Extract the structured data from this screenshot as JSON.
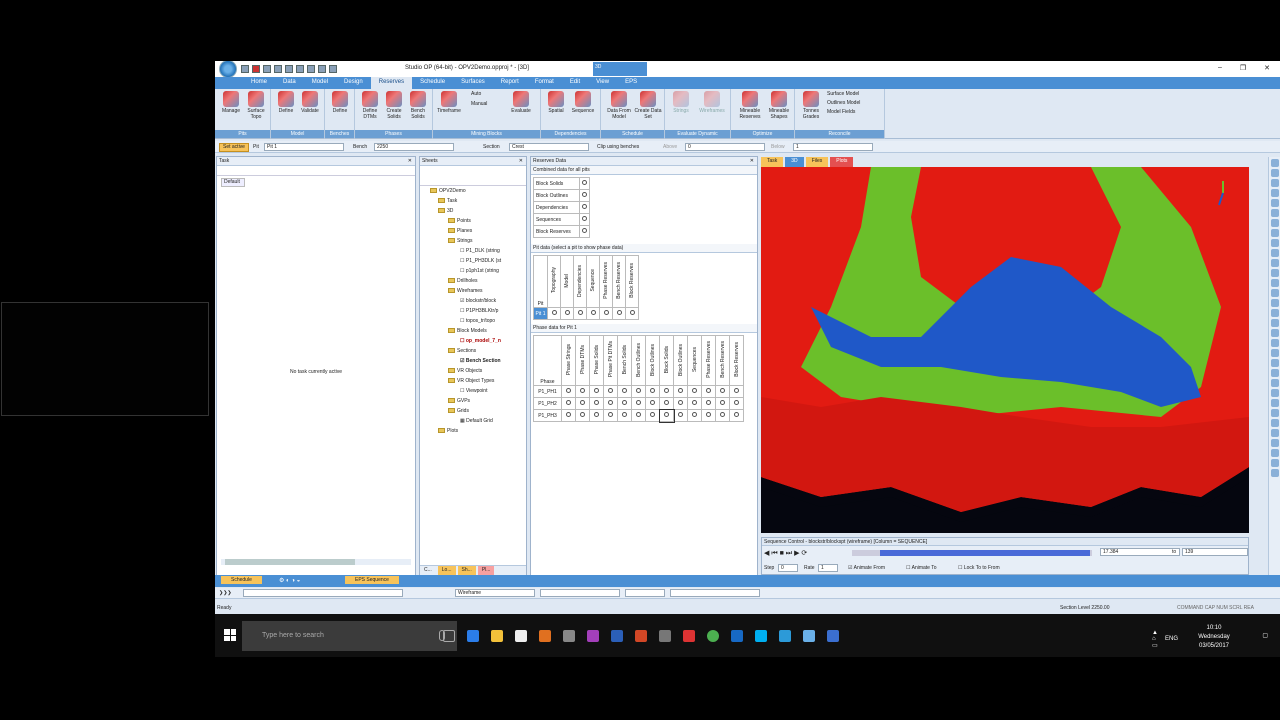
{
  "window": {
    "title": "Studio OP (64-bit) - OPV2Demo.opproj * - [3D]",
    "context_tab": "3D"
  },
  "ribbon_tabs": [
    "Home",
    "Data",
    "Model",
    "Design",
    "Reserves",
    "Schedule",
    "Surfaces",
    "Report",
    "Format",
    "Edit",
    "View",
    "EPS"
  ],
  "active_tab": "Reserves",
  "ribbon": {
    "groups": {
      "pits": "Pits",
      "model": "Model",
      "benches": "Benches",
      "phases": "Phases",
      "mining_blocks": "Mining Blocks",
      "dependencies": "Dependencies",
      "schedule": "Schedule",
      "evaluate_dynamic": "Evaluate Dynamic",
      "optimize": "Optimize",
      "reconcile": "Reconcile"
    },
    "buttons": {
      "manage": "Manage",
      "surface_topo": "Surface Topo",
      "define_model": "Define",
      "validate": "Validate",
      "define_benches": "Define",
      "define_dtms": "Define DTMs",
      "create_solids": "Create Solids",
      "bench_solids": "Bench Solids",
      "timeframe": "Timeframe",
      "auto": "Auto",
      "manual": "Manual",
      "evaluate": "Evaluate",
      "spatial": "Spatial",
      "sequence": "Sequence",
      "data_from_model": "Data From Model",
      "create_data_set": "Create Data Set",
      "strings": "Strings",
      "wireframes": "Wireframes",
      "mineable_reserves": "Mineable Reserves",
      "mineable_shapes": "Mineable Shapes",
      "tonnes_grades": "Tonnes Grades",
      "surface_model": "Surface Model",
      "outlines_model": "Outlines Model",
      "model_fields": "Model Fields"
    }
  },
  "bar1": {
    "set_active": "Set active",
    "pit_label": "Pit",
    "pit_value": "Pit 1",
    "bench_label": "Bench",
    "bench_value": "2250",
    "section_label": "Section",
    "section_value": "Crest",
    "clip_label": "Clip using benches",
    "above_label": "Above",
    "above_value": "0",
    "below_label": "Below",
    "below_value": "1"
  },
  "task_panel": {
    "title": "Task",
    "tab": "Default",
    "empty_message": "No task currently active"
  },
  "sheets_panel": {
    "title": "Sheets",
    "tree": [
      "OPV2Demo",
      "Task",
      "3D",
      "Points",
      "Planes",
      "Strings",
      "P1_DLK (string",
      "P1_PH3DLK (st",
      "p1ph1st (string",
      "Drillholes",
      "Wireframes",
      "blockstr/block",
      "P1PH3BLKtr/p",
      "topos_tr/topo",
      "Block Models",
      "op_model_7_n",
      "Sections",
      "Bench Section",
      "VR Objects",
      "VR Object Types",
      "Viewpoint",
      "GVPs",
      "Grids",
      "Default Grid",
      "Plots"
    ],
    "bottom_tabs": [
      "C...",
      "Lo...",
      "Sh...",
      "Pl..."
    ]
  },
  "reserves_panel": {
    "title": "Reserves Data",
    "combined_header": "Combined data for all pits",
    "combined_rows": [
      "Block Solids",
      "Block Outlines",
      "Dependencies",
      "Sequences",
      "Block Reserves"
    ],
    "pit_header": "Pit data (select a pit to show phase data)",
    "pit_columns": [
      "Topography",
      "Model",
      "Dependencies",
      "Sequence",
      "Phase Reserves",
      "Bench Reserves",
      "Block Reserves"
    ],
    "pit_row_label": "Pit",
    "pit_row": "Pit 1",
    "phase_header": "Phase data for Pit 1",
    "phase_row_label": "Phase",
    "phase_columns": [
      "Phase Strings",
      "Phase DTMs",
      "Phase Solids",
      "Phase Pit DTMs",
      "Bench Solids",
      "Bench Outlines",
      "Block Outlines",
      "Block Solids",
      "Block Outlines",
      "Sequences",
      "Phase Reserves",
      "Bench Reserves",
      "Block Reserves"
    ],
    "phases": [
      "P1_PH1",
      "P1_PH2",
      "P1_PH3"
    ]
  },
  "viewport": {
    "tabs": [
      "Task",
      "3D",
      "Files",
      "Plots"
    ]
  },
  "sequence_control": {
    "title": "Sequence Control - blockstr/blockspt (wireframe) [Column = SEQUENCE]",
    "value_from": "17.384",
    "to_label": "to",
    "value_to": "139",
    "step_label": "Step",
    "step_value": "0",
    "rate_label": "Rate",
    "rate_value": "1",
    "animate_from": "Animate From",
    "animate_to": "Animate To",
    "lock_to_from": "Lock To to From"
  },
  "bottom_tabs": [
    "Schedule",
    "EPS Sequence"
  ],
  "cmd_bar": {
    "layer": "Wireframe"
  },
  "status": {
    "ready": "Ready",
    "section_level": "Section Level 2250.00",
    "indicators": "COMMAND CAP NUM SCRL REA"
  },
  "taskbar": {
    "search_placeholder": "Type here to search",
    "lang": "ENG",
    "time": "10:10",
    "day": "Wednesday",
    "date": "03/05/2017"
  }
}
